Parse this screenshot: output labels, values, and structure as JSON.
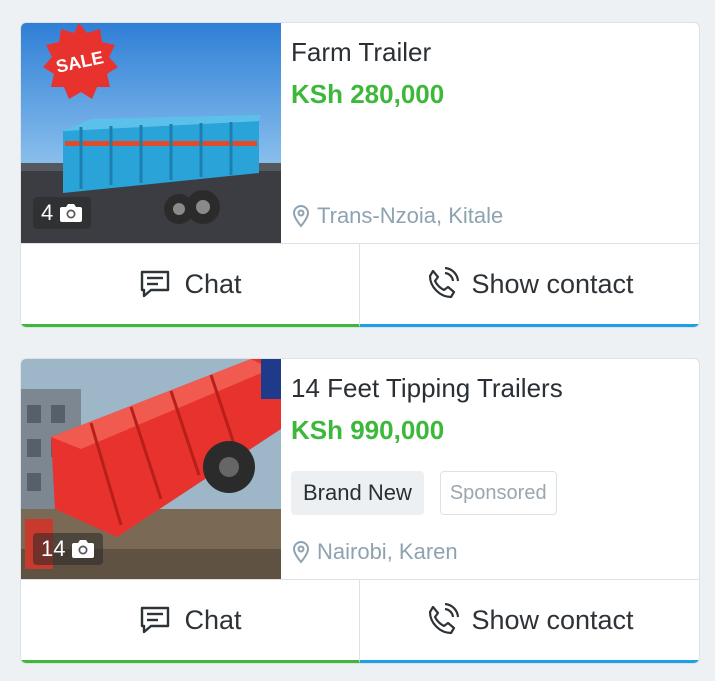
{
  "listings": [
    {
      "title": "Farm Trailer",
      "price": "KSh 280,000",
      "photo_count": "4",
      "badge": "SALE",
      "tags": [],
      "location": "Trans-Nzoia, Kitale",
      "chat_label": "Chat",
      "contact_label": "Show contact"
    },
    {
      "title": "14 Feet Tipping Trailers",
      "price": "KSh 990,000",
      "photo_count": "14",
      "tags": [
        "Brand New",
        "Sponsored"
      ],
      "location": "Nairobi, Karen",
      "chat_label": "Chat",
      "contact_label": "Show contact"
    }
  ],
  "colors": {
    "price": "#3db83a",
    "chat_accent": "#3db83a",
    "contact_accent": "#1aa0e6",
    "location": "#8ea3b2"
  },
  "icons": [
    "camera-icon",
    "location-pin-icon",
    "chat-icon",
    "phone-icon"
  ]
}
